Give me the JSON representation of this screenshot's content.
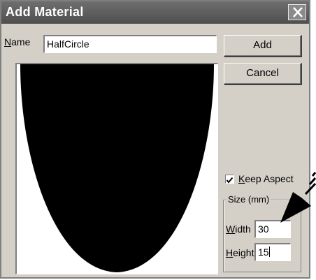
{
  "window": {
    "title": "Add Material"
  },
  "name_field": {
    "label_underline": "N",
    "label_rest": "ame",
    "value": "HalfCircle"
  },
  "buttons": {
    "add": "Add",
    "cancel": "Cancel"
  },
  "keep_aspect": {
    "label_underline": "K",
    "label_rest": "eep Aspect",
    "checked": true
  },
  "size_group": {
    "legend": "Size (mm)",
    "width": {
      "label_underline": "W",
      "label_rest": "idth",
      "value": "30"
    },
    "height": {
      "label_underline": "H",
      "label_rest": "eight",
      "value": "15"
    }
  },
  "icons": {
    "close": "close-icon",
    "checkmark": "checkmark-icon",
    "arrow": "pointer-arrow-icon"
  },
  "colors": {
    "titlebar": "#5a5a5a",
    "dialog_bg": "#d4d0c8",
    "shape_fill": "#000000"
  }
}
